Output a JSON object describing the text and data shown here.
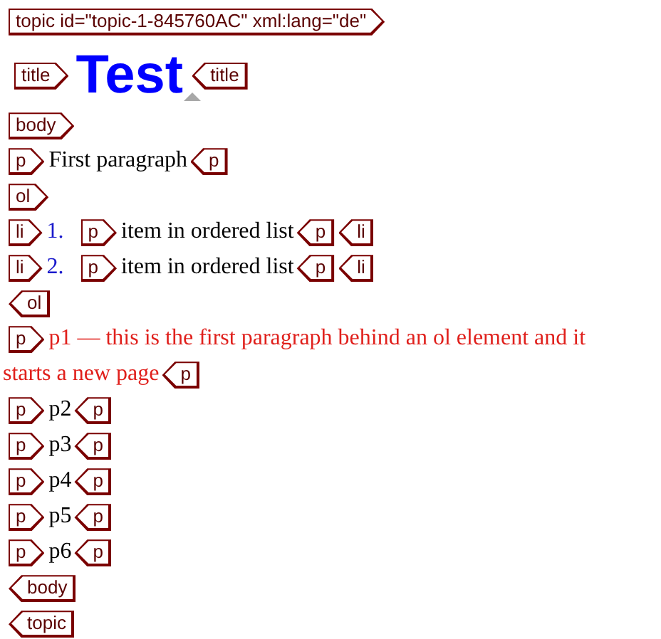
{
  "lines": [
    {
      "items": [
        {
          "kind": "open",
          "label": "topic id=\"topic-1-845760AC\" xml:lang=\"de\""
        }
      ]
    },
    {
      "items": [
        {
          "kind": "open",
          "label": "title"
        },
        {
          "kind": "title",
          "text": "Test"
        },
        {
          "kind": "close",
          "label": "title"
        }
      ]
    },
    {
      "items": [
        {
          "kind": "open",
          "label": "body"
        }
      ]
    },
    {
      "items": [
        {
          "kind": "open",
          "label": "p"
        },
        {
          "kind": "text",
          "text": "First paragraph",
          "color": "#000000"
        },
        {
          "kind": "close",
          "label": "p"
        }
      ]
    },
    {
      "items": [
        {
          "kind": "open",
          "label": "ol"
        }
      ]
    },
    {
      "items": [
        {
          "kind": "open",
          "label": "li"
        },
        {
          "kind": "number",
          "text": "1."
        },
        {
          "kind": "open",
          "label": "p"
        },
        {
          "kind": "text",
          "text": "item in ordered list",
          "color": "#000000"
        },
        {
          "kind": "close",
          "label": "p"
        },
        {
          "kind": "close",
          "label": "li"
        }
      ]
    },
    {
      "items": [
        {
          "kind": "open",
          "label": "li"
        },
        {
          "kind": "number",
          "text": "2."
        },
        {
          "kind": "open",
          "label": "p"
        },
        {
          "kind": "text",
          "text": "item in ordered list",
          "color": "#000000"
        },
        {
          "kind": "close",
          "label": "p"
        },
        {
          "kind": "close",
          "label": "li"
        }
      ]
    },
    {
      "items": [
        {
          "kind": "close",
          "label": "ol"
        }
      ]
    },
    {
      "items": [
        {
          "kind": "open",
          "label": "p"
        },
        {
          "kind": "text",
          "text": "p1 — this is the first paragraph behind an ol element and it",
          "color": "#e0201c"
        },
        {
          "kind": "text",
          "text": "starts a new page",
          "color": "#e0201c"
        },
        {
          "kind": "close",
          "label": "p"
        }
      ]
    },
    {
      "items": [
        {
          "kind": "open",
          "label": "p"
        },
        {
          "kind": "text",
          "text": "p2",
          "color": "#000000"
        },
        {
          "kind": "close",
          "label": "p"
        }
      ]
    },
    {
      "items": [
        {
          "kind": "open",
          "label": "p"
        },
        {
          "kind": "text",
          "text": "p3",
          "color": "#000000"
        },
        {
          "kind": "close",
          "label": "p"
        }
      ]
    },
    {
      "items": [
        {
          "kind": "open",
          "label": "p"
        },
        {
          "kind": "text",
          "text": "p4",
          "color": "#000000"
        },
        {
          "kind": "close",
          "label": "p"
        }
      ]
    },
    {
      "items": [
        {
          "kind": "open",
          "label": "p"
        },
        {
          "kind": "text",
          "text": "p5",
          "color": "#000000"
        },
        {
          "kind": "close",
          "label": "p"
        }
      ]
    },
    {
      "items": [
        {
          "kind": "open",
          "label": "p"
        },
        {
          "kind": "text",
          "text": "p6",
          "color": "#000000"
        },
        {
          "kind": "close",
          "label": "p"
        }
      ]
    },
    {
      "items": [
        {
          "kind": "close",
          "label": "body"
        }
      ]
    },
    {
      "items": [
        {
          "kind": "close",
          "label": "topic"
        }
      ]
    }
  ]
}
